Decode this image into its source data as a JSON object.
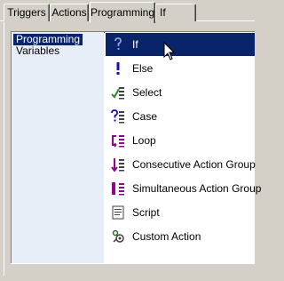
{
  "tabs": [
    {
      "label": "Triggers",
      "active": false
    },
    {
      "label": "Actions",
      "active": false
    },
    {
      "label": "Programming",
      "active": true
    },
    {
      "label": "If",
      "active": false
    }
  ],
  "left_list": {
    "items": [
      {
        "label": "Programming",
        "selected": true
      },
      {
        "label": "Variables",
        "selected": false
      }
    ]
  },
  "actions": {
    "items": [
      {
        "label": "If",
        "icon": "if-icon",
        "selected": true
      },
      {
        "label": "Else",
        "icon": "else-icon",
        "selected": false
      },
      {
        "label": "Select",
        "icon": "select-icon",
        "selected": false
      },
      {
        "label": "Case",
        "icon": "case-icon",
        "selected": false
      },
      {
        "label": "Loop",
        "icon": "loop-icon",
        "selected": false
      },
      {
        "label": "Consecutive Action Group",
        "icon": "consecutive-group-icon",
        "selected": false
      },
      {
        "label": "Simultaneous Action Group",
        "icon": "simultaneous-group-icon",
        "selected": false
      },
      {
        "label": "Script",
        "icon": "script-icon",
        "selected": false
      },
      {
        "label": "Custom Action",
        "icon": "custom-action-icon",
        "selected": false
      }
    ]
  },
  "colors": {
    "selection": "#0a246a",
    "face": "#d4d0c8",
    "icon_blue": "#1010c0",
    "icon_purple": "#8a0a8a",
    "icon_green": "#2a8a2a"
  }
}
